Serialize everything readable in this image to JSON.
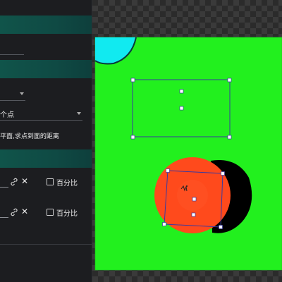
{
  "panel": {
    "dropdown_point": {
      "value": "个点"
    },
    "description": "平面,求点到面的距离",
    "rows": [
      {
        "checkbox_label": "百分比",
        "checked": false
      },
      {
        "checkbox_label": "百分比",
        "checked": false
      }
    ]
  },
  "icons": {
    "link": "link-icon",
    "close": "close-icon",
    "caret": "chevron-down-icon"
  },
  "colors": {
    "accent_header": "#10544a",
    "canvas_green": "#22f01e",
    "cyan_shape": "#11eaf0",
    "orange_circle": "#ff4a1c",
    "shadow": "#000000",
    "selection_stroke": "#3a3aa0"
  }
}
